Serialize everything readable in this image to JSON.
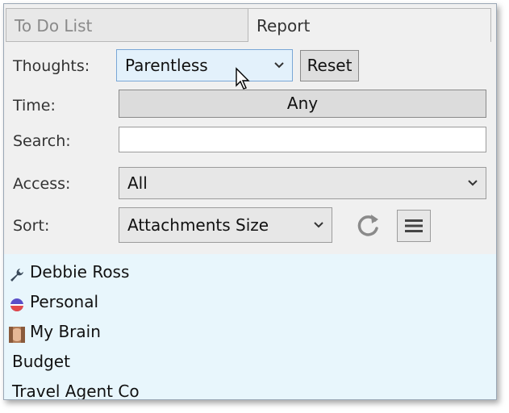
{
  "tabs": [
    {
      "label": "To Do List"
    },
    {
      "label": "Report"
    }
  ],
  "filters": {
    "thoughts_label": "Thoughts:",
    "thoughts_value": "Parentless",
    "reset_label": "Reset",
    "time_label": "Time:",
    "time_value": "Any",
    "search_label": "Search:",
    "search_value": "",
    "access_label": "Access:",
    "access_value": "All",
    "sort_label": "Sort:",
    "sort_value": "Attachments Size"
  },
  "icons": {
    "refresh": "refresh-icon",
    "menu": "menu-icon"
  },
  "list": [
    {
      "label": "Debbie Ross",
      "icon": "wrench-icon"
    },
    {
      "label": "Personal",
      "icon": "personal-type-icon"
    },
    {
      "label": "My Brain",
      "icon": "brain-avatar-icon"
    },
    {
      "label": "Budget",
      "icon": ""
    },
    {
      "label": "Travel Agent Co",
      "icon": ""
    }
  ],
  "colors": {
    "list_background": "#e8f6fc",
    "dropdown_highlight": "#e3f1fb"
  }
}
